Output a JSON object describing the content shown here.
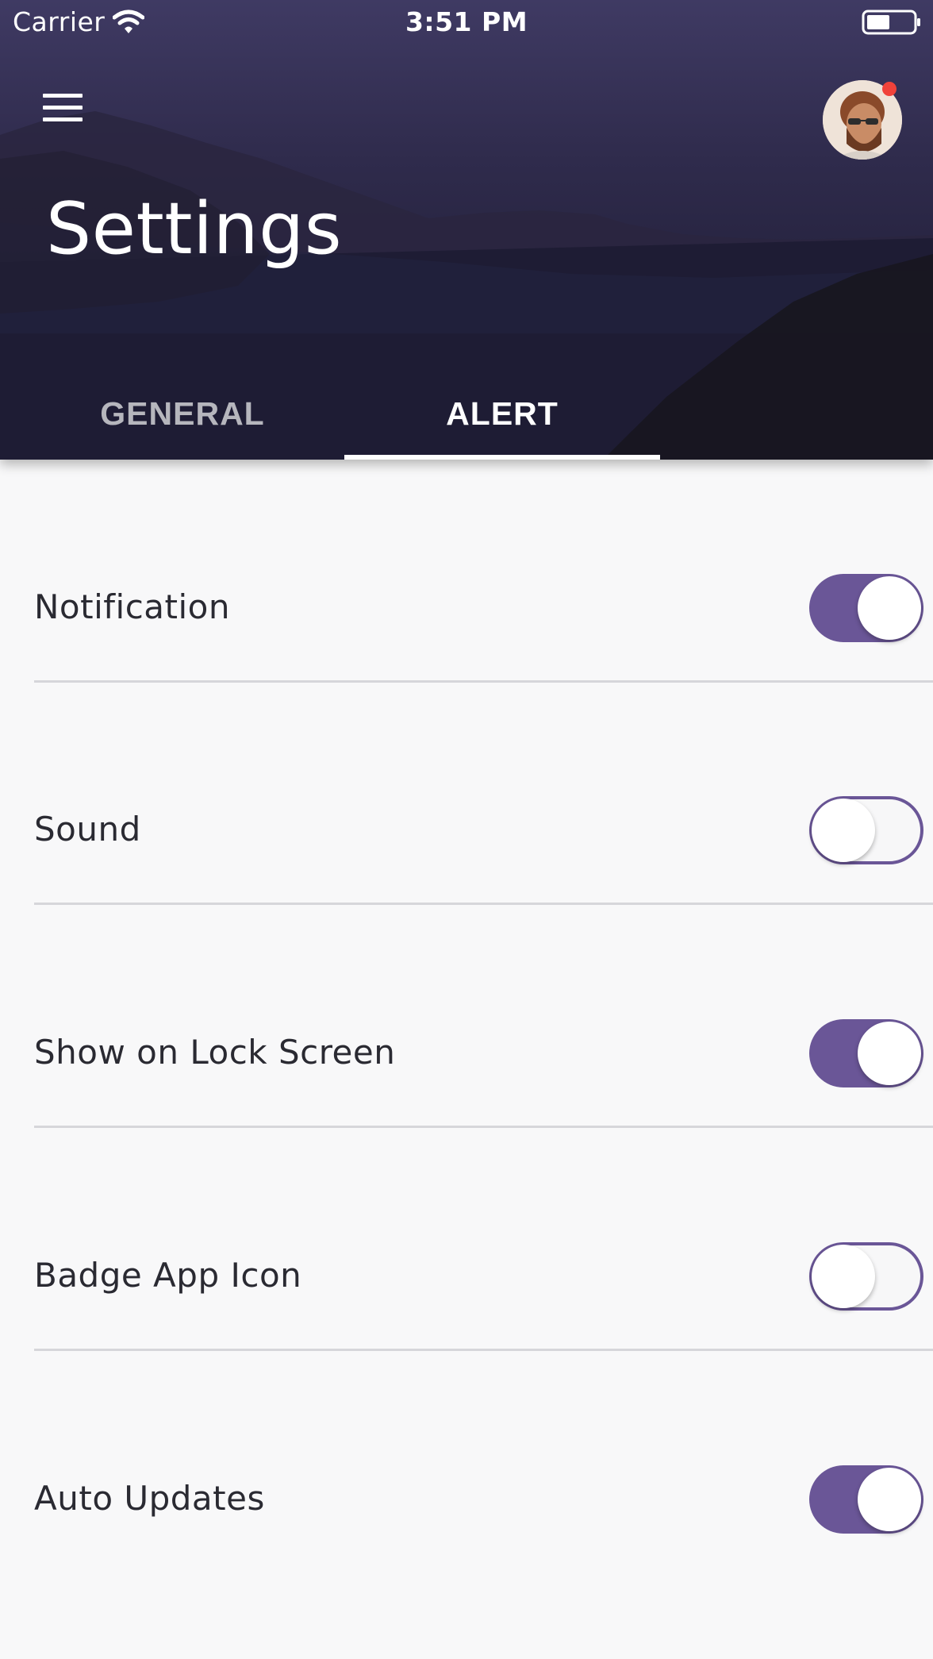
{
  "status_bar": {
    "carrier": "Carrier",
    "time": "3:51 PM",
    "wifi_icon": "wifi-icon",
    "battery_icon": "battery-icon"
  },
  "header": {
    "title": "Settings",
    "menu_icon": "hamburger-menu-icon",
    "avatar_icon": "user-avatar",
    "notification_dot_color": "#f0423a"
  },
  "tabs": [
    {
      "label": "GENERAL",
      "selected": false
    },
    {
      "label": "ALERT",
      "selected": true
    }
  ],
  "settings": [
    {
      "label": "Notification",
      "enabled": true
    },
    {
      "label": "Sound",
      "enabled": false
    },
    {
      "label": "Show on Lock Screen",
      "enabled": true
    },
    {
      "label": "Badge App Icon",
      "enabled": false
    },
    {
      "label": "Auto Updates",
      "enabled": true
    }
  ],
  "colors": {
    "accent": "#6a5697",
    "header_background": "#2f2b4c",
    "page_background": "#f8f8f9",
    "text": "#2a2a32",
    "divider": "#d6d6da"
  }
}
